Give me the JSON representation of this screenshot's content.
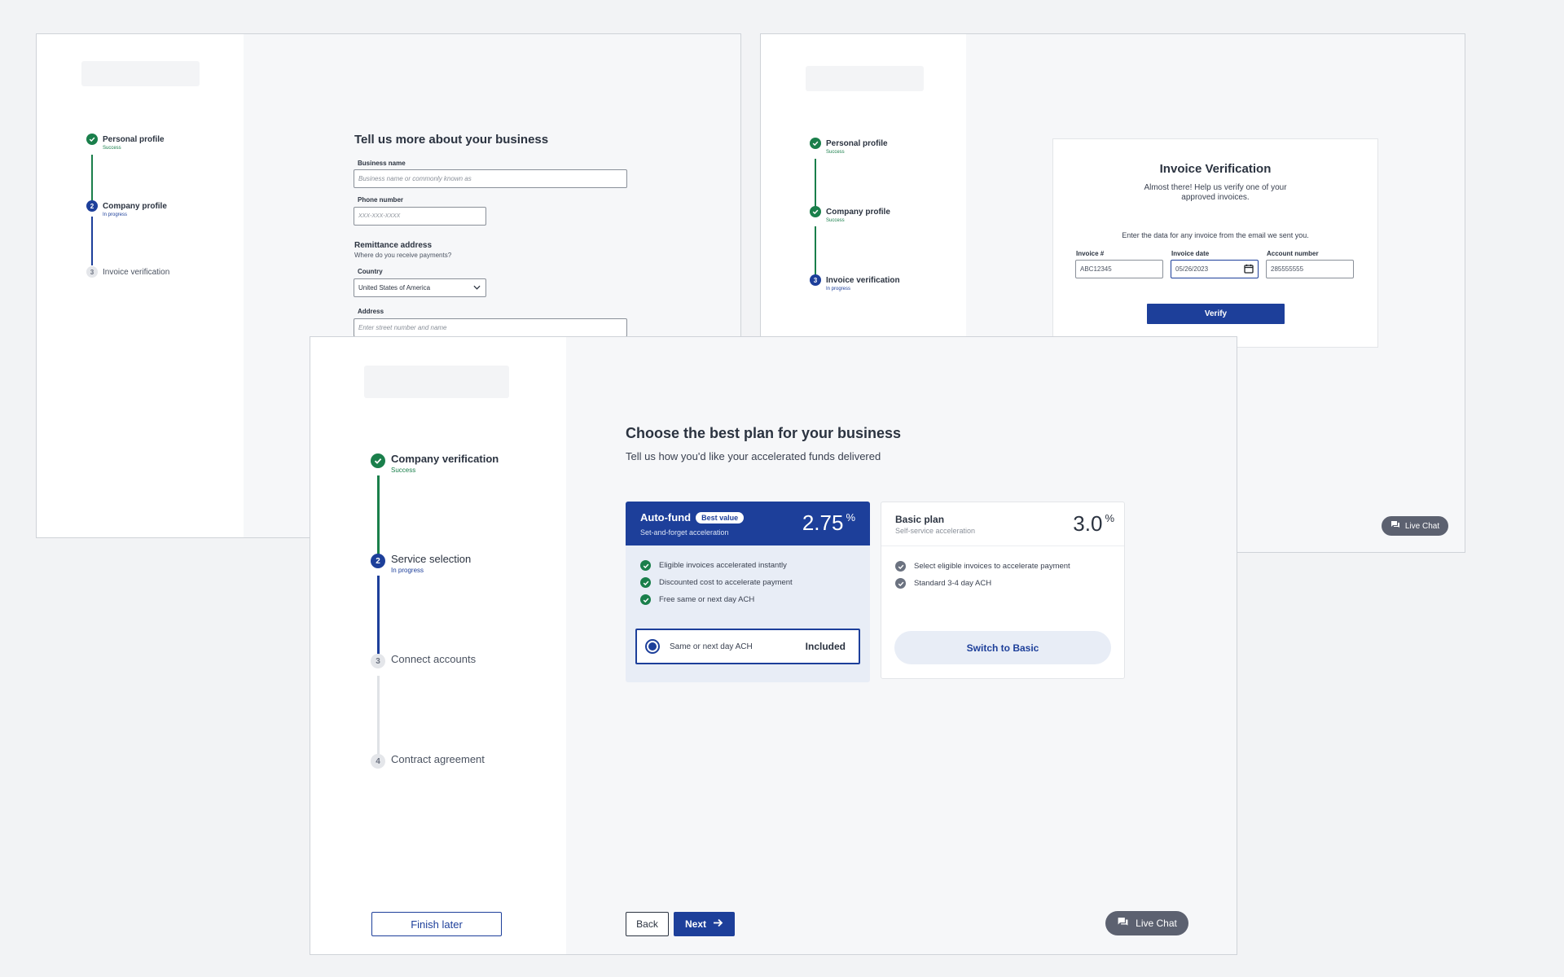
{
  "w1": {
    "steps": [
      {
        "label": "Personal profile",
        "status": "Success"
      },
      {
        "label": "Company profile",
        "status": "In progress",
        "num": "2"
      },
      {
        "label": "Invoice verification",
        "num": "3"
      }
    ],
    "title": "Tell us more about your business",
    "business_name_label": "Business name",
    "business_name_placeholder": "Business name or commonly known as",
    "phone_label": "Phone number",
    "phone_placeholder": "XXX-XXX-XXXX",
    "remit_title": "Remittance address",
    "remit_sub": "Where do you receive payments?",
    "country_label": "Country",
    "country_value": "United States of America",
    "address_label": "Address",
    "address_placeholder": "Enter street number and name"
  },
  "w2": {
    "steps": [
      {
        "label": "Personal profile",
        "status": "Success"
      },
      {
        "label": "Company profile",
        "status": "Success"
      },
      {
        "label": "Invoice verification",
        "status": "In progress",
        "num": "3"
      }
    ],
    "title": "Invoice Verification",
    "subtitle_1": "Almost there! Help us verify one of your",
    "subtitle_2": "approved invoices.",
    "instr": "Enter the data for any invoice from the email we sent you.",
    "invoice_label": "Invoice #",
    "invoice_value": "ABC12345",
    "date_label": "Invoice date",
    "date_value": "05/26/2023",
    "account_label": "Account number",
    "account_value": "285555555",
    "verify": "Verify",
    "chat": "Live Chat"
  },
  "w3": {
    "steps": [
      {
        "label": "Company verification",
        "status": "Success"
      },
      {
        "label": "Service selection",
        "status": "In progress",
        "num": "2"
      },
      {
        "label": "Connect accounts",
        "num": "3"
      },
      {
        "label": "Contract agreement",
        "num": "4"
      }
    ],
    "title": "Choose the best plan for your business",
    "subtitle": "Tell us how you'd like your accelerated funds delivered",
    "autofund": {
      "name": "Auto-fund",
      "badge": "Best value",
      "sub": "Set-and-forget acceleration",
      "rate": "2.75",
      "unit": "%",
      "features": [
        "Eligible invoices accelerated instantly",
        "Discounted cost to accelerate payment",
        "Free same or next day ACH"
      ],
      "option_label": "Same or next day ACH",
      "option_value": "Included"
    },
    "basic": {
      "name": "Basic plan",
      "sub": "Self-service acceleration",
      "rate": "3.0",
      "unit": "%",
      "features": [
        "Select eligible invoices to accelerate payment",
        "Standard 3-4 day ACH"
      ],
      "switch": "Switch to Basic"
    },
    "finish_later": "Finish later",
    "back": "Back",
    "next": "Next",
    "chat": "Live Chat"
  },
  "colors": {
    "success": "#1a7f4b",
    "primary": "#1d3f9a",
    "chat": "#5c6170"
  }
}
